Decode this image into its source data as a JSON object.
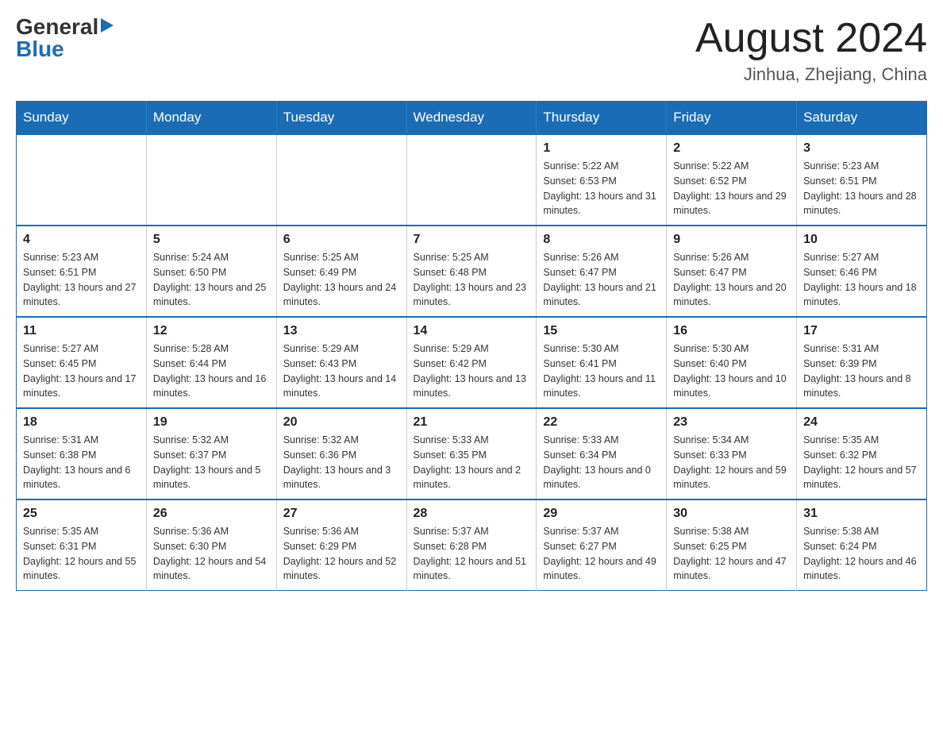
{
  "logo": {
    "general": "General",
    "blue": "Blue"
  },
  "title": {
    "month_year": "August 2024",
    "location": "Jinhua, Zhejiang, China"
  },
  "headers": [
    "Sunday",
    "Monday",
    "Tuesday",
    "Wednesday",
    "Thursday",
    "Friday",
    "Saturday"
  ],
  "weeks": [
    {
      "days": [
        {
          "num": "",
          "info": ""
        },
        {
          "num": "",
          "info": ""
        },
        {
          "num": "",
          "info": ""
        },
        {
          "num": "",
          "info": ""
        },
        {
          "num": "1",
          "info": "Sunrise: 5:22 AM\nSunset: 6:53 PM\nDaylight: 13 hours and 31 minutes."
        },
        {
          "num": "2",
          "info": "Sunrise: 5:22 AM\nSunset: 6:52 PM\nDaylight: 13 hours and 29 minutes."
        },
        {
          "num": "3",
          "info": "Sunrise: 5:23 AM\nSunset: 6:51 PM\nDaylight: 13 hours and 28 minutes."
        }
      ]
    },
    {
      "days": [
        {
          "num": "4",
          "info": "Sunrise: 5:23 AM\nSunset: 6:51 PM\nDaylight: 13 hours and 27 minutes."
        },
        {
          "num": "5",
          "info": "Sunrise: 5:24 AM\nSunset: 6:50 PM\nDaylight: 13 hours and 25 minutes."
        },
        {
          "num": "6",
          "info": "Sunrise: 5:25 AM\nSunset: 6:49 PM\nDaylight: 13 hours and 24 minutes."
        },
        {
          "num": "7",
          "info": "Sunrise: 5:25 AM\nSunset: 6:48 PM\nDaylight: 13 hours and 23 minutes."
        },
        {
          "num": "8",
          "info": "Sunrise: 5:26 AM\nSunset: 6:47 PM\nDaylight: 13 hours and 21 minutes."
        },
        {
          "num": "9",
          "info": "Sunrise: 5:26 AM\nSunset: 6:47 PM\nDaylight: 13 hours and 20 minutes."
        },
        {
          "num": "10",
          "info": "Sunrise: 5:27 AM\nSunset: 6:46 PM\nDaylight: 13 hours and 18 minutes."
        }
      ]
    },
    {
      "days": [
        {
          "num": "11",
          "info": "Sunrise: 5:27 AM\nSunset: 6:45 PM\nDaylight: 13 hours and 17 minutes."
        },
        {
          "num": "12",
          "info": "Sunrise: 5:28 AM\nSunset: 6:44 PM\nDaylight: 13 hours and 16 minutes."
        },
        {
          "num": "13",
          "info": "Sunrise: 5:29 AM\nSunset: 6:43 PM\nDaylight: 13 hours and 14 minutes."
        },
        {
          "num": "14",
          "info": "Sunrise: 5:29 AM\nSunset: 6:42 PM\nDaylight: 13 hours and 13 minutes."
        },
        {
          "num": "15",
          "info": "Sunrise: 5:30 AM\nSunset: 6:41 PM\nDaylight: 13 hours and 11 minutes."
        },
        {
          "num": "16",
          "info": "Sunrise: 5:30 AM\nSunset: 6:40 PM\nDaylight: 13 hours and 10 minutes."
        },
        {
          "num": "17",
          "info": "Sunrise: 5:31 AM\nSunset: 6:39 PM\nDaylight: 13 hours and 8 minutes."
        }
      ]
    },
    {
      "days": [
        {
          "num": "18",
          "info": "Sunrise: 5:31 AM\nSunset: 6:38 PM\nDaylight: 13 hours and 6 minutes."
        },
        {
          "num": "19",
          "info": "Sunrise: 5:32 AM\nSunset: 6:37 PM\nDaylight: 13 hours and 5 minutes."
        },
        {
          "num": "20",
          "info": "Sunrise: 5:32 AM\nSunset: 6:36 PM\nDaylight: 13 hours and 3 minutes."
        },
        {
          "num": "21",
          "info": "Sunrise: 5:33 AM\nSunset: 6:35 PM\nDaylight: 13 hours and 2 minutes."
        },
        {
          "num": "22",
          "info": "Sunrise: 5:33 AM\nSunset: 6:34 PM\nDaylight: 13 hours and 0 minutes."
        },
        {
          "num": "23",
          "info": "Sunrise: 5:34 AM\nSunset: 6:33 PM\nDaylight: 12 hours and 59 minutes."
        },
        {
          "num": "24",
          "info": "Sunrise: 5:35 AM\nSunset: 6:32 PM\nDaylight: 12 hours and 57 minutes."
        }
      ]
    },
    {
      "days": [
        {
          "num": "25",
          "info": "Sunrise: 5:35 AM\nSunset: 6:31 PM\nDaylight: 12 hours and 55 minutes."
        },
        {
          "num": "26",
          "info": "Sunrise: 5:36 AM\nSunset: 6:30 PM\nDaylight: 12 hours and 54 minutes."
        },
        {
          "num": "27",
          "info": "Sunrise: 5:36 AM\nSunset: 6:29 PM\nDaylight: 12 hours and 52 minutes."
        },
        {
          "num": "28",
          "info": "Sunrise: 5:37 AM\nSunset: 6:28 PM\nDaylight: 12 hours and 51 minutes."
        },
        {
          "num": "29",
          "info": "Sunrise: 5:37 AM\nSunset: 6:27 PM\nDaylight: 12 hours and 49 minutes."
        },
        {
          "num": "30",
          "info": "Sunrise: 5:38 AM\nSunset: 6:25 PM\nDaylight: 12 hours and 47 minutes."
        },
        {
          "num": "31",
          "info": "Sunrise: 5:38 AM\nSunset: 6:24 PM\nDaylight: 12 hours and 46 minutes."
        }
      ]
    }
  ]
}
